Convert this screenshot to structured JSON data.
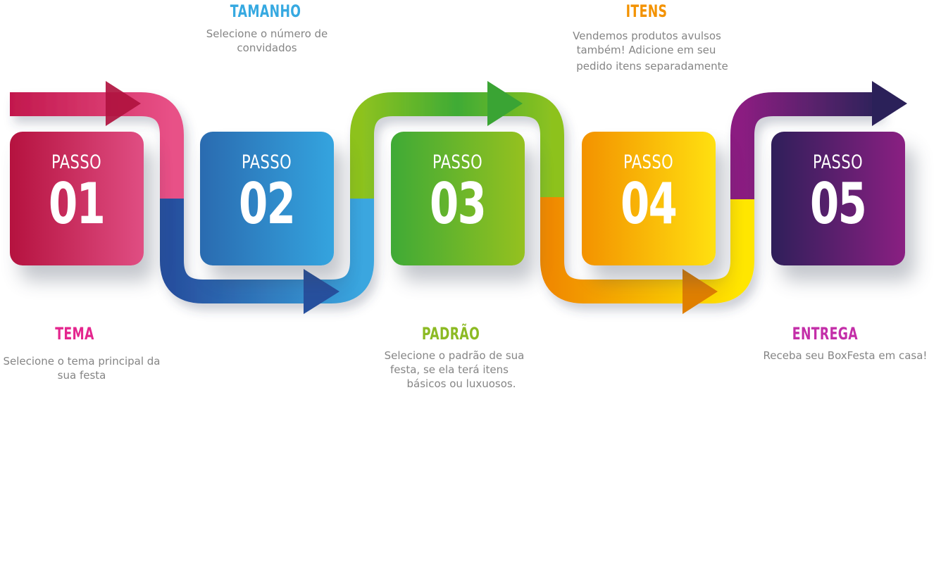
{
  "steps": [
    {
      "word": "PASSO",
      "number": "01",
      "title": "TEMA",
      "title_color": "#e4268e",
      "desc": [
        "Selecione o tema principal da",
        "sua festa"
      ]
    },
    {
      "word": "PASSO",
      "number": "02",
      "title": "TAMANHO",
      "title_color": "#36a9e1",
      "desc": [
        "Selecione o número de",
        "convidados"
      ]
    },
    {
      "word": "PASSO",
      "number": "03",
      "title": "PADRÃO",
      "title_color": "#8cba23",
      "desc": [
        "Selecione o padrão de sua",
        "festa, se ela terá itens",
        "básicos ou luxuosos."
      ]
    },
    {
      "word": "PASSO",
      "number": "04",
      "title": "ITENS",
      "title_color": "#f39200",
      "desc": [
        "Vendemos produtos avulsos",
        "também! Adicione em seu",
        "pedido itens separadamente"
      ]
    },
    {
      "word": "PASSO",
      "number": "05",
      "title": "ENTREGA",
      "title_color": "#c32ea8",
      "desc": [
        "Receba seu BoxFesta em casa!"
      ]
    }
  ]
}
